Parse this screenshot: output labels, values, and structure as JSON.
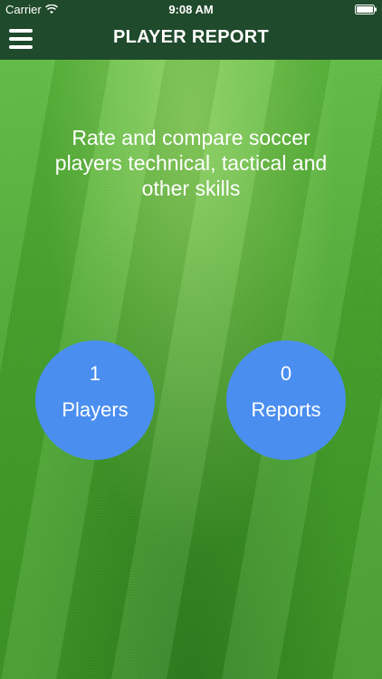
{
  "status_bar": {
    "carrier": "Carrier",
    "time": "9:08 AM",
    "icons": [
      "wifi-icon",
      "battery-icon"
    ]
  },
  "nav": {
    "title": "PLAYER REPORT",
    "menu_icon": "hamburger-menu-icon"
  },
  "main": {
    "tagline": "Rate and compare soccer players technical, tactical and other skills",
    "stats": [
      {
        "count": "1",
        "label": "Players"
      },
      {
        "count": "0",
        "label": "Reports"
      }
    ]
  },
  "colors": {
    "header_bg": "#1f4a2b",
    "circle_bg": "#4a8ef0",
    "text": "#ffffff"
  }
}
